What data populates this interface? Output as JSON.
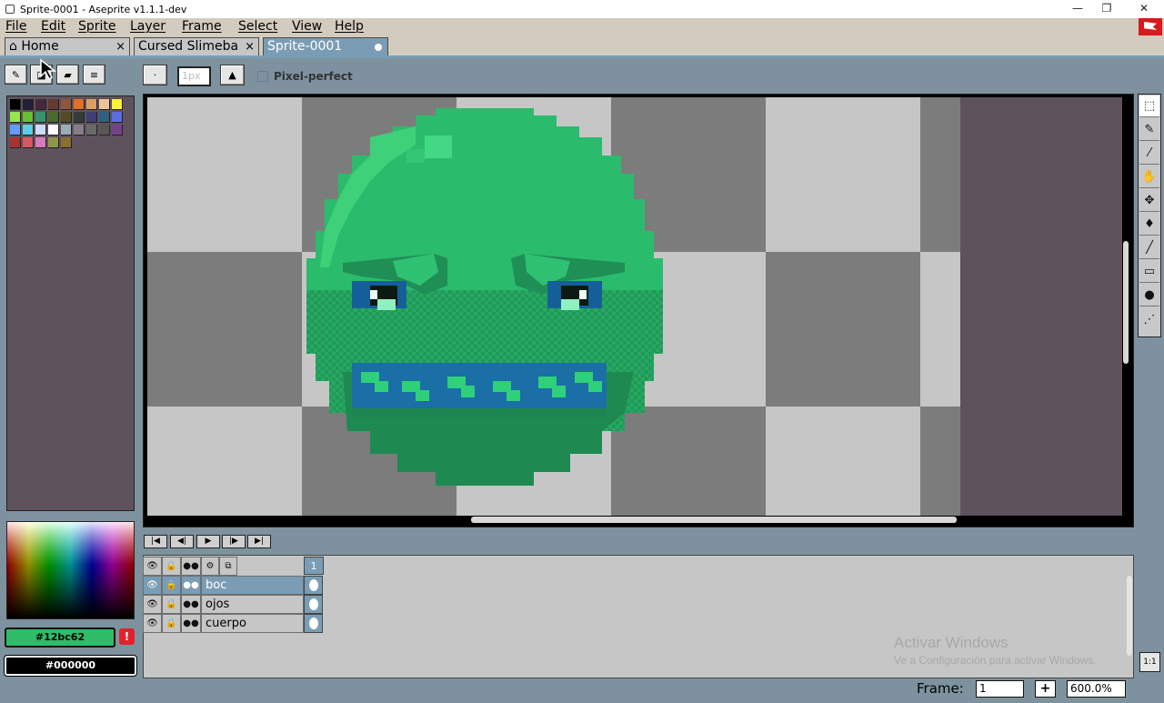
{
  "window": {
    "title": "Sprite-0001 - Aseprite v1.1.1-dev",
    "minimize": "—",
    "restore": "❐",
    "close": "✕"
  },
  "menu": [
    "File",
    "Edit",
    "Sprite",
    "Layer",
    "Frame",
    "Select",
    "View",
    "Help"
  ],
  "tabs": [
    {
      "label": "Home",
      "close": "×"
    },
    {
      "label": "Cursed Slimeba",
      "close": "×"
    },
    {
      "label": "Sprite-0001"
    }
  ],
  "toolbar": {
    "brush_size": "1px",
    "pixel_perfect_label": "Pixel-perfect"
  },
  "palette": {
    "swatches": [
      "#000000",
      "#222034",
      "#45283c",
      "#663931",
      "#8f563b",
      "#df7126",
      "#d9a066",
      "#eec39a",
      "#fbf236",
      "#99e550",
      "#6abe30",
      "#37946e",
      "#4b692f",
      "#524b24",
      "#323c39",
      "#3f3f74",
      "#306082",
      "#5b6ee1",
      "#639bff",
      "#5fcde4",
      "#cbdbfc",
      "#ffffff",
      "#9badb7",
      "#847e87",
      "#696a6a",
      "#595652",
      "#76428a",
      "#ac3232",
      "#d95763",
      "#d77bba",
      "#8f974a",
      "#8a6f30"
    ]
  },
  "colors": {
    "foreground": "#12bc62",
    "background": "#000000",
    "accent": "#7a9db5"
  },
  "timeline": {
    "frame_number": "1",
    "layers": [
      {
        "name": "boc",
        "selected": true
      },
      {
        "name": "ojos",
        "selected": false
      },
      {
        "name": "cuerpo",
        "selected": false
      }
    ]
  },
  "watermark": {
    "line1": "Activar Windows",
    "line2": "Ve a Configuración para activar Windows."
  },
  "status": {
    "frame_label": "Frame:",
    "frame_value": "1",
    "plus": "+",
    "zoom": "600.0%",
    "ratio": "1:1"
  }
}
